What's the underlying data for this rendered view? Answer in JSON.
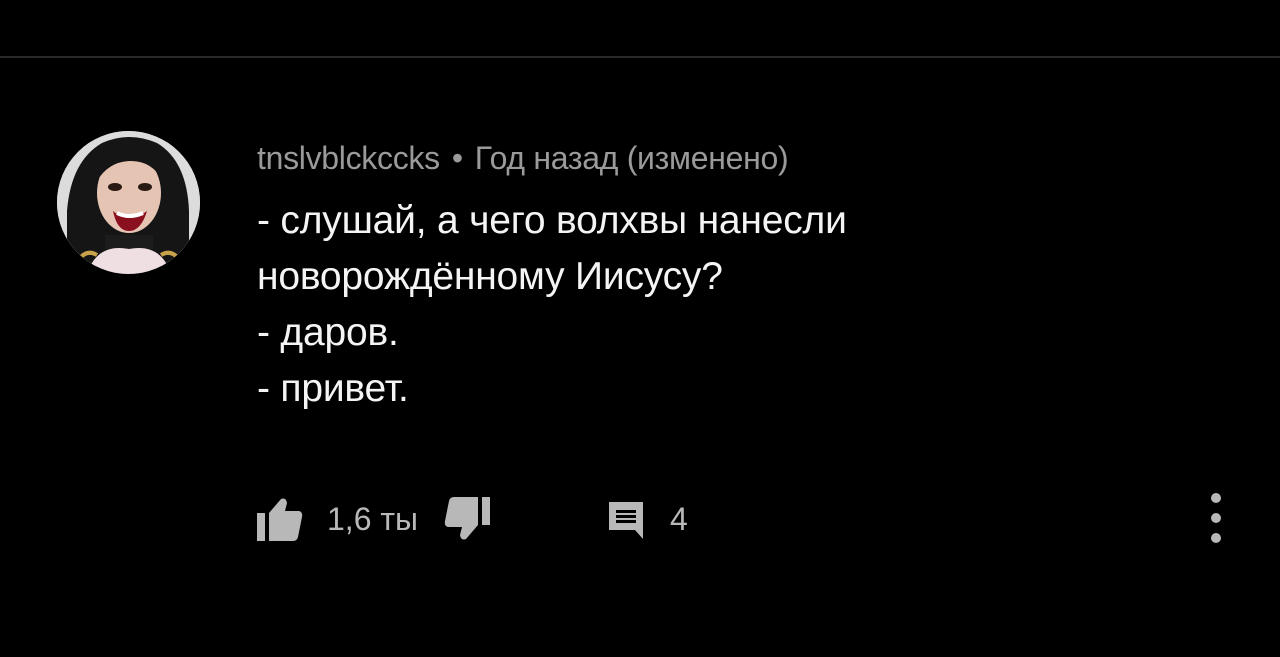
{
  "comment": {
    "author": "tnslvblckccks",
    "separator": "•",
    "timestamp": "Год назад (изменено)",
    "lines": [
      "- слушай, а чего волхвы нанесли",
      "новорождённому Иисусу?",
      "- даров.",
      "- привет."
    ]
  },
  "actions": {
    "like_icon": "thumbs-up-icon",
    "like_count": "1,6 ты",
    "dislike_icon": "thumbs-down-icon",
    "reply_icon": "comment-icon",
    "reply_count": "4",
    "more_icon": "more-vertical-icon"
  },
  "colors": {
    "background": "#000000",
    "text_primary": "#f4f4f4",
    "text_secondary": "#9a9a9a",
    "icon": "#b8b8b8"
  }
}
